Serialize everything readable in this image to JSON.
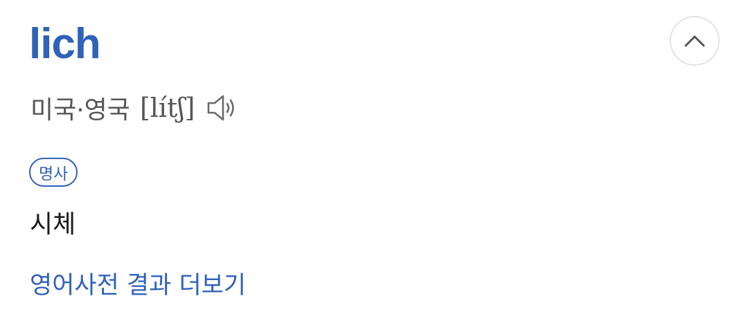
{
  "entry": {
    "headword": "lich",
    "pronunciation": {
      "region": "미국·영국",
      "ipa": "[lítʃ]",
      "speaker_icon": "speaker-icon"
    },
    "part_of_speech": "명사",
    "meaning": "시체"
  },
  "actions": {
    "collapse_icon": "chevron-up-icon",
    "more_link_label": "영어사전 결과 더보기"
  },
  "colors": {
    "accent": "#2f62b9",
    "text": "#1a1a1a",
    "muted": "#555555",
    "border": "#e3e3e3"
  }
}
